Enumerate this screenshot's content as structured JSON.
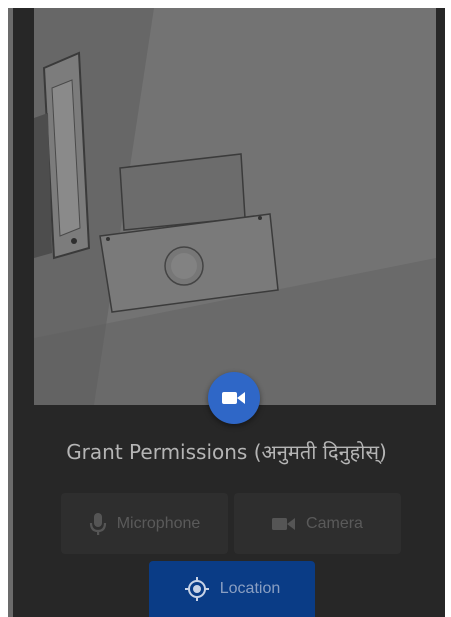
{
  "camera": {
    "record_icon": "videocam-icon"
  },
  "permissions": {
    "title": "Grant Permissions (अनुमती दिनुहोस्)",
    "microphone": {
      "label": "Microphone",
      "icon": "microphone-icon"
    },
    "camera": {
      "label": "Camera",
      "icon": "videocam-icon"
    },
    "location": {
      "label": "Location",
      "icon": "location-target-icon"
    }
  },
  "colors": {
    "background": "#272727",
    "record_button": "#2f67c7",
    "location_button": "#0a3c86",
    "disabled_button": "#2e2e2e",
    "title_text": "#b5b5b5"
  }
}
